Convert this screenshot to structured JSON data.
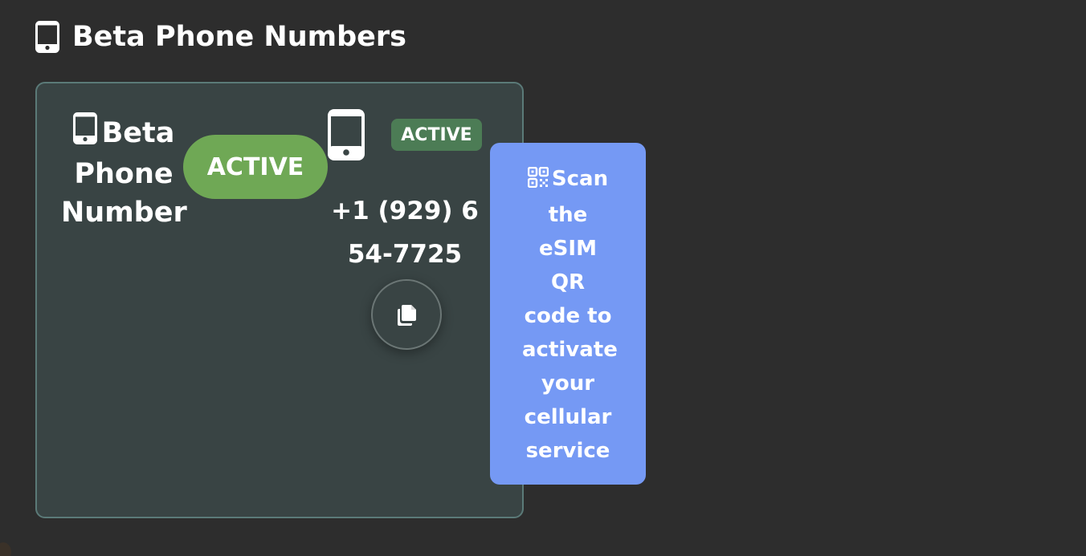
{
  "header": {
    "icon": "mobile-phone-icon",
    "title": "Beta Phone Numbers"
  },
  "card": {
    "icon": "mobile-phone-icon",
    "title": "Beta Phone Number",
    "status_pill": "ACTIVE",
    "device_icon": "mobile-phone-icon",
    "status_badge": "ACTIVE",
    "phone_number": "+1 (929) 654-7725",
    "copy_icon": "copy-icon"
  },
  "tooltip": {
    "icon": "qr-code-icon",
    "text": "Scan the eSIM QR code to activate your cellular service"
  },
  "colors": {
    "background": "#2d2d2d",
    "card_background": "#394444",
    "card_border": "#5b7a78",
    "status_pill": "#6fa855",
    "status_badge": "#4c7c55",
    "tooltip_background": "#7599f4"
  }
}
